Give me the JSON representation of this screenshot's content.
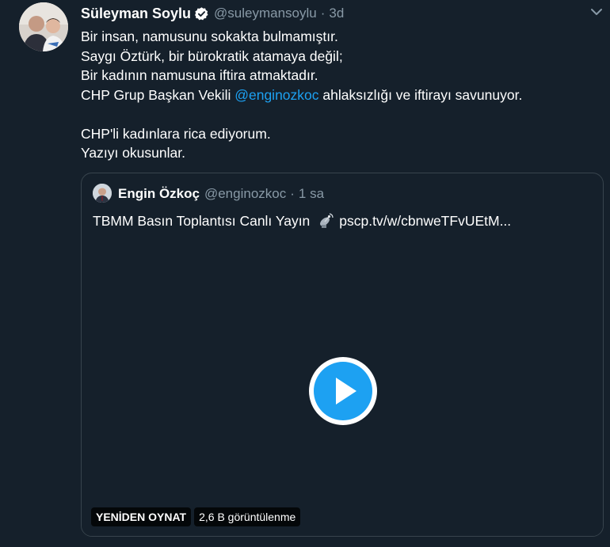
{
  "tweet": {
    "author_name": "Süleyman Soylu",
    "author_handle": "@suleymansoylu",
    "separator": "·",
    "time": "3d",
    "verified_icon": "verified-badge-icon",
    "menu_icon": "chevron-down-icon",
    "lines": [
      {
        "text": "Bir insan, namusunu sokakta bulmamıştır."
      },
      {
        "text": "Saygı Öztürk, bir bürokratik atamaya değil;"
      },
      {
        "text": "Bir kadının namusuna iftira atmaktadır."
      },
      {
        "pre": "CHP Grup Başkan Vekili ",
        "mention": "@enginozkoc",
        "post": " ahlaksızlığı ve iftirayı savunuyor."
      },
      {
        "text": ""
      },
      {
        "text": "CHP'li kadınlara rica ediyorum."
      },
      {
        "text": "Yazıyı okusunlar."
      }
    ]
  },
  "quote": {
    "author_name": "Engin Özkoç",
    "author_handle": "@enginozkoc",
    "separator": "·",
    "time": "1 sa",
    "text_before": "TBMM Basın Toplantısı  Canlı Yayın",
    "text_icon": "satellite-antenna-icon",
    "link": "pscp.tv/w/cbnweTFvUEtM...",
    "video": {
      "play_icon": "play-icon",
      "replay_label": "YENİDEN OYNAT",
      "views_label": "2,6 B görüntülenme"
    }
  },
  "colors": {
    "background": "#15202b",
    "accent": "#1da1f2",
    "secondary_text": "#8899a6",
    "border": "#38444d"
  }
}
